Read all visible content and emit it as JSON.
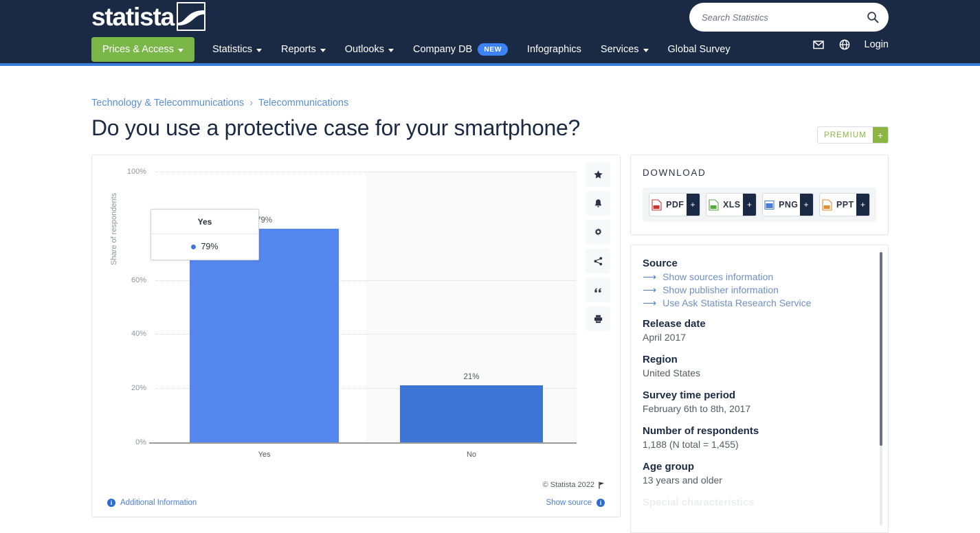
{
  "header": {
    "logo_text": "statista",
    "search": {
      "placeholder": "Search Statistics",
      "value": "",
      "icon": "search-icon"
    },
    "nav": [
      {
        "label": "Prices & Access",
        "caret": true,
        "active": true
      },
      {
        "label": "Statistics",
        "caret": true
      },
      {
        "label": "Reports",
        "caret": true
      },
      {
        "label": "Outlooks",
        "caret": true
      },
      {
        "label": "Company DB",
        "badge": "NEW"
      },
      {
        "label": "Infographics"
      },
      {
        "label": "Services",
        "caret": true
      },
      {
        "label": "Global Survey"
      }
    ],
    "right": {
      "mail_icon": "envelope-icon",
      "globe_icon": "globe-icon",
      "login_label": "Login"
    }
  },
  "breadcrumb": {
    "items": [
      "Technology & Telecommunications",
      "Telecommunications"
    ],
    "separator": "›"
  },
  "page_title": "Do you use a protective case for your smartphone?",
  "premium_badge": {
    "label": "PREMIUM",
    "plus": "+",
    "color": "#8cb544"
  },
  "chart_toolbar": [
    {
      "name": "favorite-star-icon",
      "title": "star"
    },
    {
      "name": "notification-bell-icon",
      "title": "bell"
    },
    {
      "name": "settings-gear-icon",
      "title": "gear"
    },
    {
      "name": "share-icon",
      "title": "share"
    },
    {
      "name": "citation-quote-icon",
      "title": "quote"
    },
    {
      "name": "print-icon",
      "title": "print"
    }
  ],
  "chart_footer": {
    "copyright": "© Statista 2022",
    "flag_icon": "flag-icon",
    "additional_information": "Additional Information",
    "show_source": "Show source",
    "info_icon": "info-icon"
  },
  "download": {
    "title": "DOWNLOAD",
    "buttons": [
      {
        "label": "PDF",
        "plus": "+",
        "icon": "pdf-file-icon",
        "color": "#c9342b"
      },
      {
        "label": "XLS",
        "plus": "+",
        "icon": "xls-file-icon",
        "color": "#56a83a"
      },
      {
        "label": "PNG",
        "plus": "+",
        "icon": "png-file-icon",
        "color": "#4a7fd0"
      },
      {
        "label": "PPT",
        "plus": "+",
        "icon": "ppt-file-icon",
        "color": "#e08a33"
      }
    ]
  },
  "source_panel": {
    "source_heading": "Source",
    "links": [
      "Show sources information",
      "Show publisher information",
      "Use Ask Statista Research Service"
    ],
    "meta": [
      {
        "label": "Release date",
        "value": "April 2017"
      },
      {
        "label": "Region",
        "value": "United States"
      },
      {
        "label": "Survey time period",
        "value": "February 6th to 8th, 2017"
      },
      {
        "label": "Number of respondents",
        "value": "1,188 (N total = 1,455)"
      },
      {
        "label": "Age group",
        "value": "13 years and older"
      }
    ],
    "clipped_label": "Special characteristics"
  },
  "chart_data": {
    "type": "bar",
    "title": "Do you use a protective case for your smartphone?",
    "categories": [
      "Yes",
      "No"
    ],
    "values": [
      79,
      21
    ],
    "value_labels": [
      "79%",
      "21%"
    ],
    "xlabel": "",
    "ylabel": "Share of respondents",
    "ylim": [
      0,
      100
    ],
    "yticks": [
      0,
      20,
      40,
      60,
      100
    ],
    "ytick_labels": [
      "0%",
      "20%",
      "40%",
      "60%",
      "100%"
    ],
    "grid": true,
    "legend": false,
    "bar_colors": [
      "#5588ef",
      "#3e76d6"
    ],
    "tooltip": {
      "header": "Yes",
      "value": "79%",
      "dot_color": "#3e76d6"
    }
  }
}
